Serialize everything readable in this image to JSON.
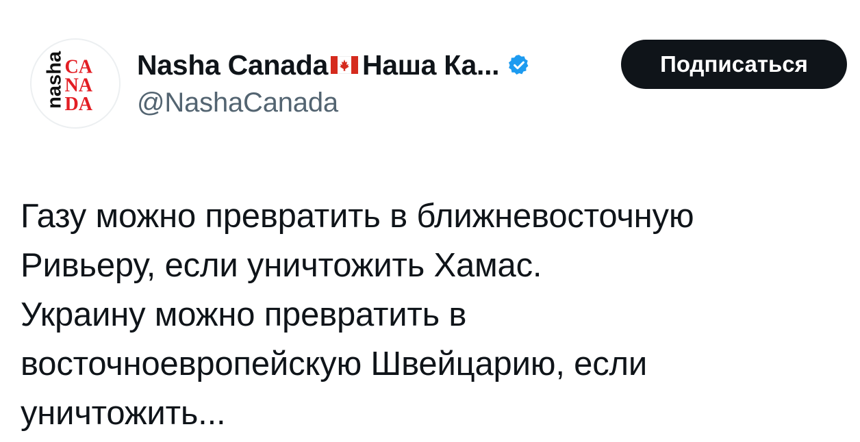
{
  "author": {
    "display_name_latin": "Nasha Canada",
    "display_name_cyrillic": "Наша Ка...",
    "handle": "@NashaCanada",
    "flag_icon": "canada-flag-icon",
    "verified_icon": "verified-badge-icon",
    "avatar": {
      "side_text": "nasha",
      "letters_line1": "CA",
      "letters_line2": "NA",
      "letters_line3": "DA",
      "brand_color": "#e31e24"
    }
  },
  "actions": {
    "follow_label": "Подписаться"
  },
  "tweet": {
    "lines": [
      "Газу можно превратить в ближневосточную",
      "Ривьеру, если уничтожить Хамас.",
      "Украину можно превратить в",
      "восточноевропейскую Швейцарию, если",
      "уничтожить..."
    ]
  },
  "colors": {
    "text": "#0f1419",
    "secondary_text": "#536471",
    "button_bg": "#0f1419",
    "verified_blue": "#1d9bf0"
  }
}
